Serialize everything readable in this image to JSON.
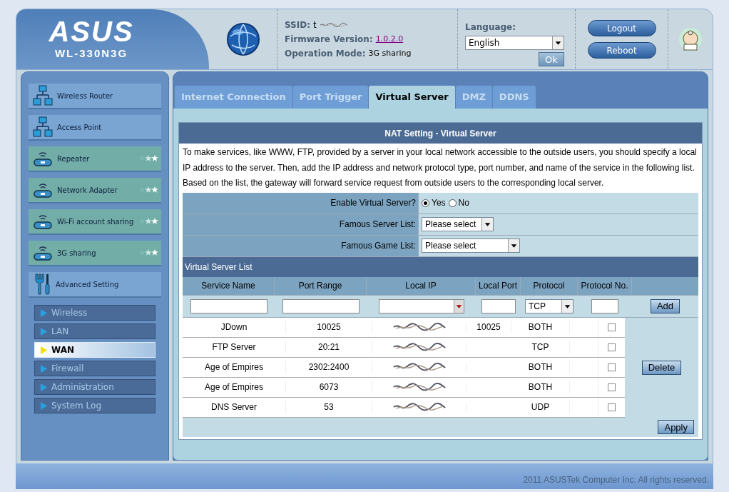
{
  "header": {
    "logo": "ASUS",
    "model": "WL-330N3G",
    "ssid_label": "SSID:",
    "ssid_value": "t",
    "firmware_label": "Firmware Version:",
    "firmware_value": "1.0.2.0",
    "mode_label": "Operation Mode:",
    "mode_value": "3G sharing",
    "language_label": "Language:",
    "language_value": "English",
    "ok_button": "Ok",
    "buttons": [
      "Logout",
      "Reboot"
    ]
  },
  "sidebar": {
    "items": [
      {
        "label": "Wireless Router",
        "kind": "router"
      },
      {
        "label": "Access Point",
        "kind": "router"
      },
      {
        "label": "Repeater",
        "kind": "wireless"
      },
      {
        "label": "Network Adapter",
        "kind": "wireless"
      },
      {
        "label": "Wi-Fi account sharing",
        "kind": "wireless"
      },
      {
        "label": "3G sharing",
        "kind": "wireless"
      },
      {
        "label": "Advanced Setting",
        "kind": "tools"
      }
    ],
    "subitems": [
      {
        "label": "Wireless",
        "selected": false
      },
      {
        "label": "LAN",
        "selected": false
      },
      {
        "label": "WAN",
        "selected": true
      },
      {
        "label": "Firewall",
        "selected": false
      },
      {
        "label": "Administration",
        "selected": false
      },
      {
        "label": "System Log",
        "selected": false
      }
    ]
  },
  "tabs": [
    {
      "label": "Internet Connection",
      "selected": false
    },
    {
      "label": "Port Trigger",
      "selected": false
    },
    {
      "label": "Virtual Server",
      "selected": true
    },
    {
      "label": "DMZ",
      "selected": false
    },
    {
      "label": "DDNS",
      "selected": false
    }
  ],
  "panel": {
    "title": "NAT Setting - Virtual Server",
    "description": "To make services, like WWW, FTP, provided by a server in your local network accessible to the outside users, you should specify a local IP address to the server. Then, add the IP address and network protocol type, port number, and name of the service in the following list. Based on the list, the gateway will forward service request from outside users to the corresponding local server.",
    "enable": {
      "label": "Enable Virtual Server?",
      "options": [
        {
          "label": "Yes",
          "selected": true
        },
        {
          "label": "No",
          "selected": false
        }
      ]
    },
    "server_list": {
      "label": "Famous Server List:",
      "value": "Please select"
    },
    "game_list": {
      "label": "Famous Game List:",
      "value": "Please select"
    },
    "list_title": "Virtual Server List",
    "columns": [
      "Service Name",
      "Port Range",
      "Local IP",
      "Local Port",
      "Protocol",
      "Protocol No."
    ],
    "protocol_value": "TCP",
    "add_button": "Add",
    "rows": [
      {
        "name": "JDown",
        "port_range": "10025",
        "local_port": "10025",
        "protocol": "BOTH",
        "checked": false
      },
      {
        "name": "FTP Server",
        "port_range": "20:21",
        "local_port": "",
        "protocol": "TCP",
        "checked": false
      },
      {
        "name": "Age of Empires",
        "port_range": "2302:2400",
        "local_port": "",
        "protocol": "BOTH",
        "checked": false
      },
      {
        "name": "Age of Empires",
        "port_range": "6073",
        "local_port": "",
        "protocol": "BOTH",
        "checked": false
      },
      {
        "name": "DNS Server",
        "port_range": "53",
        "local_port": "",
        "protocol": "UDP",
        "checked": false
      }
    ],
    "delete_button": "Delete",
    "apply_button": "Apply"
  },
  "footer": "2011 ASUSTek Computer Inc. All rights reserved."
}
